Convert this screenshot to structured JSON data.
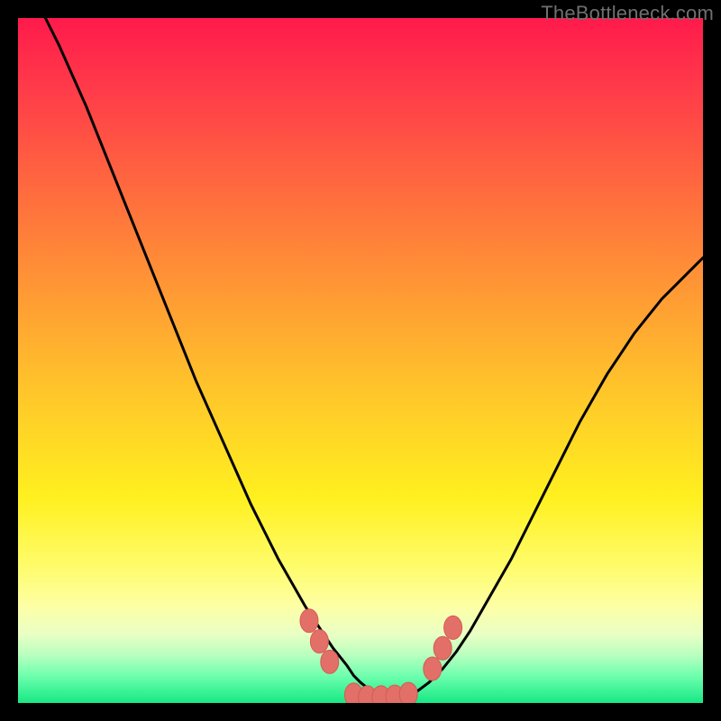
{
  "watermark": "TheBottleneck.com",
  "colors": {
    "frame": "#000000",
    "curve": "#000000",
    "marker_fill": "#e27068",
    "marker_stroke": "#d65a52",
    "gradient_stops": [
      {
        "offset": 0.0,
        "color": "#ff1a4b"
      },
      {
        "offset": 0.1,
        "color": "#ff3a4a"
      },
      {
        "offset": 0.25,
        "color": "#ff6a3e"
      },
      {
        "offset": 0.4,
        "color": "#ff9934"
      },
      {
        "offset": 0.55,
        "color": "#ffc72a"
      },
      {
        "offset": 0.7,
        "color": "#fff01f"
      },
      {
        "offset": 0.8,
        "color": "#fffc6a"
      },
      {
        "offset": 0.86,
        "color": "#fdffa6"
      },
      {
        "offset": 0.9,
        "color": "#e9ffc4"
      },
      {
        "offset": 0.93,
        "color": "#b8ffbf"
      },
      {
        "offset": 0.96,
        "color": "#6fffae"
      },
      {
        "offset": 1.0,
        "color": "#17e884"
      }
    ]
  },
  "chart_data": {
    "type": "line",
    "title": "",
    "xlabel": "",
    "ylabel": "",
    "xlim": [
      0,
      100
    ],
    "ylim": [
      0,
      100
    ],
    "x": [
      4,
      6,
      8,
      10,
      12,
      14,
      16,
      18,
      20,
      22,
      24,
      26,
      28,
      30,
      32,
      34,
      36,
      38,
      40,
      42,
      44,
      46,
      48,
      49,
      50,
      51,
      52,
      53,
      54,
      55,
      56,
      58,
      60,
      62,
      64,
      66,
      68,
      70,
      72,
      74,
      76,
      78,
      80,
      82,
      84,
      86,
      88,
      90,
      92,
      94,
      96,
      98,
      100
    ],
    "values": [
      100,
      96,
      91.5,
      87,
      82,
      77,
      72,
      67,
      62,
      57,
      52,
      47,
      42.5,
      38,
      33.5,
      29,
      25,
      21,
      17.5,
      14,
      11,
      8,
      5.5,
      4,
      3,
      2.2,
      1.5,
      1,
      0.7,
      0.7,
      0.9,
      1.5,
      3,
      5,
      7.5,
      10.5,
      14,
      17.5,
      21,
      25,
      29,
      33,
      37,
      41,
      44.5,
      48,
      51,
      54,
      56.5,
      59,
      61,
      63,
      65
    ],
    "markers": [
      {
        "x": 42.5,
        "y": 12
      },
      {
        "x": 44.0,
        "y": 9
      },
      {
        "x": 45.5,
        "y": 6
      },
      {
        "x": 49.0,
        "y": 1.2
      },
      {
        "x": 51.0,
        "y": 0.8
      },
      {
        "x": 53.0,
        "y": 0.8
      },
      {
        "x": 55.0,
        "y": 0.9
      },
      {
        "x": 57.0,
        "y": 1.3
      },
      {
        "x": 60.5,
        "y": 5
      },
      {
        "x": 62.0,
        "y": 8
      },
      {
        "x": 63.5,
        "y": 11
      }
    ]
  }
}
